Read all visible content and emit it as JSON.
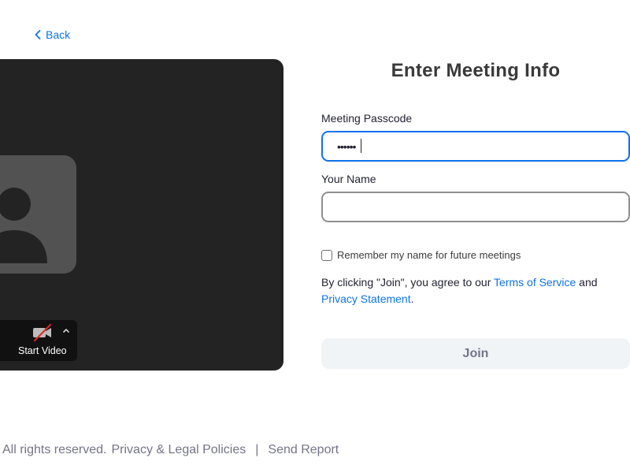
{
  "nav": {
    "back_label": "Back"
  },
  "preview": {
    "start_video_label": "Start Video"
  },
  "form": {
    "title": "Enter Meeting Info",
    "passcode_label": "Meeting Passcode",
    "passcode_value": "••••••",
    "name_label": "Your Name",
    "name_value": "",
    "remember_label": "Remember my name for future meetings",
    "agreement_prefix": "By clicking \"Join\", you agree to our ",
    "terms_link": "Terms of Service",
    "agreement_and": " and",
    "privacy_link": "Privacy Statement",
    "agreement_suffix": ".",
    "join_label": "Join"
  },
  "footer": {
    "rights_text": "All rights reserved.",
    "privacy_legal_link": "Privacy & Legal Policies",
    "separator": "|",
    "send_report_link": "Send Report"
  },
  "colors": {
    "accent": "#0e72ed",
    "preview_bg": "#232323",
    "join_disabled_bg": "#f1f4f6"
  },
  "icons": {
    "back": "chevron-left-icon",
    "avatar": "user-silhouette-icon",
    "video_off": "video-off-icon",
    "caret": "chevron-up-icon"
  }
}
